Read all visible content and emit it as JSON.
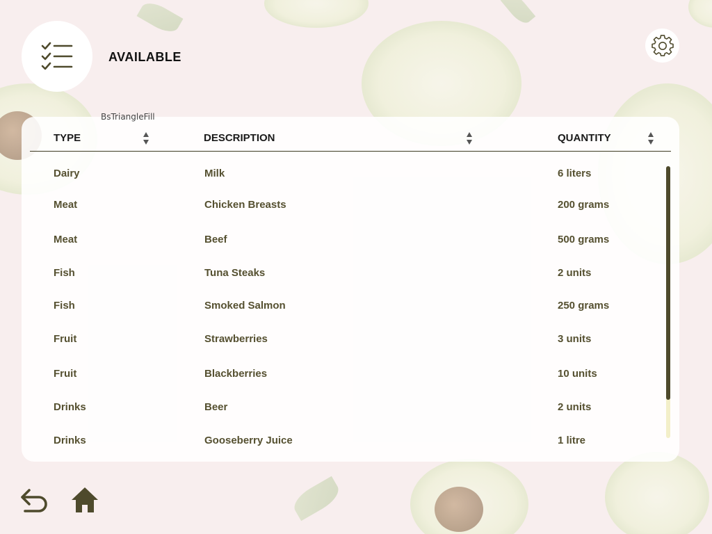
{
  "header": {
    "title": "AVAILABLE",
    "menu_icon": "checklist-icon",
    "settings_icon": "gear-icon"
  },
  "tooltip": "BsTriangleFill",
  "table": {
    "columns": [
      "TYPE",
      "DESCRIPTION",
      "QUANTITY"
    ],
    "rows": [
      {
        "type": "Dairy",
        "description": "Milk",
        "quantity": "6 liters"
      },
      {
        "type": "Meat",
        "description": "Chicken Breasts",
        "quantity": "200 grams"
      },
      {
        "type": "Meat",
        "description": "Beef",
        "quantity": "500 grams"
      },
      {
        "type": "Fish",
        "description": "Tuna Steaks",
        "quantity": "2 units"
      },
      {
        "type": "Fish",
        "description": "Smoked Salmon",
        "quantity": "250 grams"
      },
      {
        "type": "Fruit",
        "description": "Strawberries",
        "quantity": "3 units"
      },
      {
        "type": "Fruit",
        "description": "Blackberries",
        "quantity": "10 units"
      },
      {
        "type": "Drinks",
        "description": "Beer",
        "quantity": "2 units"
      },
      {
        "type": "Drinks",
        "description": "Gooseberry Juice",
        "quantity": "1 litre"
      }
    ]
  },
  "footer": {
    "back_icon": "undo-arrow-icon",
    "home_icon": "home-icon"
  },
  "colors": {
    "accent": "#4f4a2c",
    "text_dark": "#1a1a1a",
    "scroll_track": "#f3efc9",
    "panel": "#ffffff"
  }
}
